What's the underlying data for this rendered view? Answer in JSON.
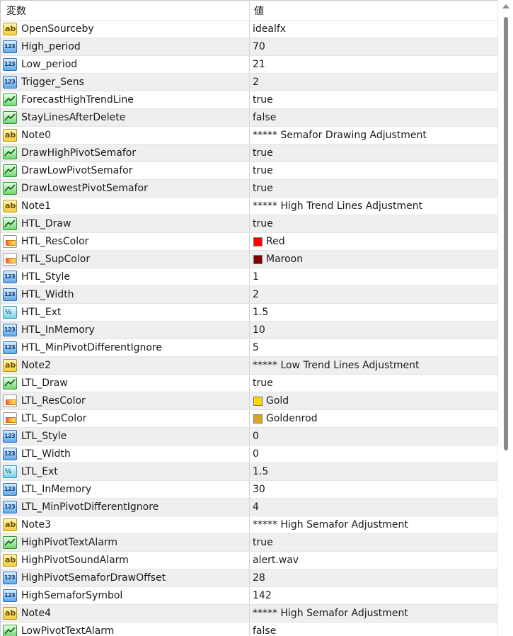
{
  "header": {
    "name_col": "変数",
    "value_col": "値"
  },
  "rows": [
    {
      "icon": "ab",
      "name": "OpenSourceby",
      "value": "idealfx"
    },
    {
      "icon": "123",
      "name": "High_period",
      "value": "70"
    },
    {
      "icon": "123",
      "name": "Low_period",
      "value": "21"
    },
    {
      "icon": "123",
      "name": "Trigger_Sens",
      "value": "2"
    },
    {
      "icon": "trend",
      "name": "ForecastHighTrendLine",
      "value": "true"
    },
    {
      "icon": "trend",
      "name": "StayLinesAfterDelete",
      "value": "false"
    },
    {
      "icon": "ab",
      "name": "Note0",
      "value": "***** Semafor Drawing Adjustment"
    },
    {
      "icon": "trend",
      "name": "DrawHighPivotSemafor",
      "value": "true"
    },
    {
      "icon": "trend",
      "name": "DrawLowPivotSemafor",
      "value": "true"
    },
    {
      "icon": "trend",
      "name": "DrawLowestPivotSemafor",
      "value": "true"
    },
    {
      "icon": "ab",
      "name": "Note1",
      "value": "***** High Trend Lines Adjustment"
    },
    {
      "icon": "trend",
      "name": "HTL_Draw",
      "value": "true"
    },
    {
      "icon": "color",
      "name": "HTL_ResColor",
      "value": "Red",
      "swatch": "#ff0000"
    },
    {
      "icon": "color",
      "name": "HTL_SupColor",
      "value": "Maroon",
      "swatch": "#800000"
    },
    {
      "icon": "123",
      "name": "HTL_Style",
      "value": "1"
    },
    {
      "icon": "123",
      "name": "HTL_Width",
      "value": "2"
    },
    {
      "icon": "half",
      "name": "HTL_Ext",
      "value": "1.5"
    },
    {
      "icon": "123",
      "name": "HTL_InMemory",
      "value": "10"
    },
    {
      "icon": "123",
      "name": "HTL_MinPivotDifferentIgnore",
      "value": "5"
    },
    {
      "icon": "ab",
      "name": "Note2",
      "value": "***** Low Trend Lines Adjustment"
    },
    {
      "icon": "trend",
      "name": "LTL_Draw",
      "value": "true"
    },
    {
      "icon": "color",
      "name": "LTL_ResColor",
      "value": "Gold",
      "swatch": "#ffd700"
    },
    {
      "icon": "color",
      "name": "LTL_SupColor",
      "value": "Goldenrod",
      "swatch": "#daa520"
    },
    {
      "icon": "123",
      "name": "LTL_Style",
      "value": "0"
    },
    {
      "icon": "123",
      "name": "LTL_Width",
      "value": "0"
    },
    {
      "icon": "half",
      "name": "LTL_Ext",
      "value": "1.5"
    },
    {
      "icon": "123",
      "name": "LTL_InMemory",
      "value": "30"
    },
    {
      "icon": "123",
      "name": "LTL_MinPivotDifferentIgnore",
      "value": "4"
    },
    {
      "icon": "ab",
      "name": "Note3",
      "value": "***** High Semafor Adjustment"
    },
    {
      "icon": "trend",
      "name": "HighPivotTextAlarm",
      "value": "true"
    },
    {
      "icon": "ab",
      "name": "HighPivotSoundAlarm",
      "value": "alert.wav"
    },
    {
      "icon": "123",
      "name": "HighPivotSemaforDrawOffset",
      "value": "28"
    },
    {
      "icon": "123",
      "name": "HighSemaforSymbol",
      "value": "142"
    },
    {
      "icon": "ab",
      "name": "Note4",
      "value": "***** High Semafor Adjustment"
    },
    {
      "icon": "trend",
      "name": "LowPivotTextAlarm",
      "value": "false"
    }
  ]
}
